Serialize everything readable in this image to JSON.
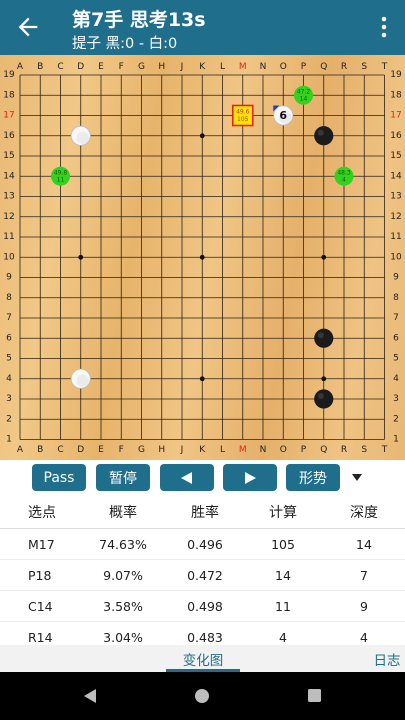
{
  "header": {
    "title": "第7手 思考13s",
    "subtitle": "提子 黑:0 - 白:0",
    "back_icon": "arrow-left-icon",
    "menu_icon": "more-vert-icon"
  },
  "board": {
    "size": 19,
    "col_labels": [
      "A",
      "B",
      "C",
      "D",
      "E",
      "F",
      "G",
      "H",
      "J",
      "K",
      "L",
      "M",
      "N",
      "O",
      "P",
      "Q",
      "R",
      "S",
      "T"
    ],
    "row_labels": [
      "19",
      "18",
      "17",
      "16",
      "15",
      "14",
      "13",
      "12",
      "11",
      "10",
      "9",
      "8",
      "7",
      "6",
      "5",
      "4",
      "3",
      "2",
      "1"
    ],
    "highlight_col": "M",
    "highlight_row": "17",
    "stones": [
      {
        "color": "white",
        "pos": "D16"
      },
      {
        "color": "white",
        "pos": "D4"
      },
      {
        "color": "white",
        "pos": "O17",
        "label": "6"
      },
      {
        "color": "black",
        "pos": "Q16"
      },
      {
        "color": "black",
        "pos": "Q6"
      },
      {
        "color": "black",
        "pos": "Q3"
      }
    ],
    "candidates": [
      {
        "pos": "M17",
        "winrate": "49.6",
        "visits": "105",
        "best": true
      },
      {
        "pos": "P18",
        "winrate": "47.2",
        "visits": "14"
      },
      {
        "pos": "C14",
        "winrate": "49.8",
        "visits": "11"
      },
      {
        "pos": "R14",
        "winrate": "48.3",
        "visits": "4"
      }
    ],
    "hoshi": [
      "D4",
      "K4",
      "Q4",
      "D10",
      "K10",
      "Q10",
      "D16",
      "K16",
      "Q16"
    ]
  },
  "toolbar": {
    "pass_label": "Pass",
    "pause_label": "暂停",
    "prev_icon": "triangle-left-icon",
    "next_icon": "triangle-right-icon",
    "situation_label": "形势",
    "dropdown_icon": "caret-down-icon"
  },
  "analysis": {
    "headers": [
      "选点",
      "概率",
      "胜率",
      "计算",
      "深度"
    ],
    "rows": [
      [
        "M17",
        "74.63%",
        "0.496",
        "105",
        "14"
      ],
      [
        "P18",
        "9.07%",
        "0.472",
        "14",
        "7"
      ],
      [
        "C14",
        "3.58%",
        "0.498",
        "11",
        "9"
      ],
      [
        "R14",
        "3.04%",
        "0.483",
        "4",
        "4"
      ]
    ]
  },
  "tabs": {
    "variation": "变化图",
    "log": "日志"
  },
  "colors": {
    "primary": "#1e6e8c",
    "highlight": "#e8211a",
    "candidate_green": "#32d21e",
    "best_candidate": "#ffe600"
  }
}
